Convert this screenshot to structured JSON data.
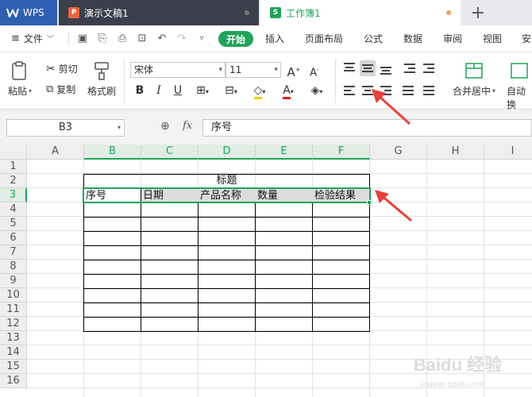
{
  "tabs": {
    "wps": "WPS",
    "presentation": "演示文稿1",
    "workbook": "工作簿1",
    "add": "+"
  },
  "menu": {
    "file": "文件",
    "items": [
      "开始",
      "插入",
      "页面布局",
      "公式",
      "数据",
      "审阅",
      "视图",
      "安"
    ]
  },
  "ribbon": {
    "paste": "粘贴",
    "cut": "剪切",
    "copy": "复制",
    "format_painter": "格式刷",
    "font_name": "宋体",
    "font_size": "11",
    "bold": "B",
    "italic": "I",
    "underline": "U",
    "merge_center": "合并居中",
    "auto_wrap": "自动换"
  },
  "formula_bar": {
    "name_box": "B3",
    "fx": "fx",
    "value": "序号"
  },
  "sheet": {
    "columns": [
      "A",
      "B",
      "C",
      "D",
      "E",
      "F",
      "G",
      "H",
      "I"
    ],
    "rows": [
      "1",
      "2",
      "3",
      "4",
      "5",
      "6",
      "7",
      "8",
      "9",
      "10",
      "11",
      "12",
      "13",
      "14",
      "15",
      "16"
    ],
    "title_cell": "标题",
    "headers": [
      "序号",
      "日期",
      "产品名称",
      "数量",
      "检验结果"
    ]
  },
  "watermark": {
    "logo": "Baidu 经验",
    "url": "jingyan.baidu.com"
  },
  "colors": {
    "accent": "#21a35a",
    "arrow": "#e8413c"
  }
}
